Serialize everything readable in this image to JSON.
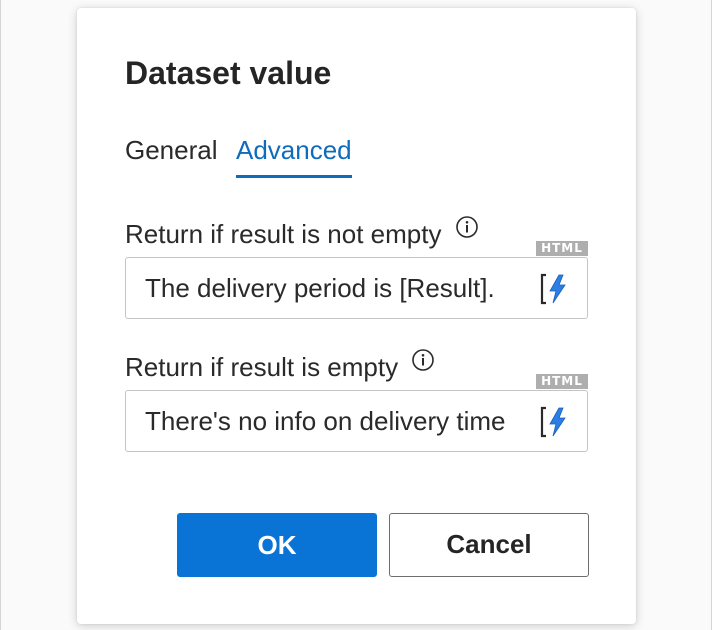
{
  "dialog": {
    "title": "Dataset value"
  },
  "tabs": [
    {
      "label": "General",
      "active": false
    },
    {
      "label": "Advanced",
      "active": true
    }
  ],
  "fields": [
    {
      "label": "Return if result is not empty",
      "badge": "HTML",
      "value": "The delivery period is [Result]."
    },
    {
      "label": "Return if result is empty",
      "badge": "HTML",
      "value": "There's no info on delivery time"
    }
  ],
  "buttons": {
    "ok_label": "OK",
    "cancel_label": "Cancel"
  },
  "colors": {
    "accent": "#0f6cbd",
    "ok_button": "#0a74d6",
    "badge": "#aeaeae",
    "lightning": "#2b7ee6"
  },
  "icons": {
    "info": "info-icon",
    "dynamic_content": "lightning-bracket-icon"
  }
}
